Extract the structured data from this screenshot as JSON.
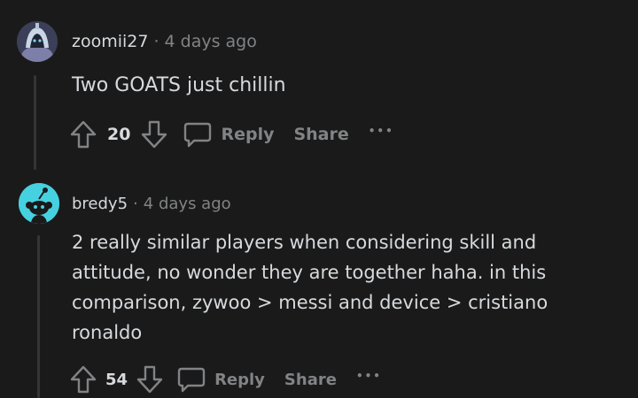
{
  "comments": [
    {
      "username": "zoomii27",
      "separator": "·",
      "timestamp": "4 days ago",
      "lines": [
        "Two GOATS just chillin"
      ],
      "votes": "20",
      "reply_label": "Reply",
      "share_label": "Share",
      "more_label": "•••",
      "avatar": "snoo-avatar-hooded"
    },
    {
      "username": "bredy5",
      "separator": "·",
      "timestamp": "4 days ago",
      "lines": [
        "2 really similar players when considering skill and",
        "attitude, no wonder they are together haha. in this",
        "comparison, zywoo > messi and device > cristiano",
        "ronaldo"
      ],
      "votes": "54",
      "reply_label": "Reply",
      "share_label": "Share",
      "more_label": "•••",
      "avatar": "snoo-avatar-default"
    }
  ],
  "colors": {
    "background": "#1a1a1b",
    "text": "#d7dadc",
    "muted": "#818384",
    "thread_line": "#343536",
    "avatar_teal": "#46d1e0"
  }
}
